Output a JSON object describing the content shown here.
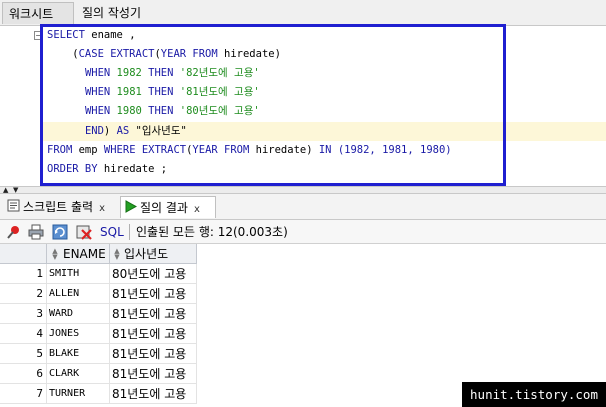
{
  "tabs": [
    {
      "label": "워크시트"
    },
    {
      "label": "질의 작성기"
    }
  ],
  "editor": {
    "lines": [
      [
        {
          "t": "SELECT ",
          "c": "kw"
        },
        {
          "t": "ename ,",
          "c": ""
        }
      ],
      [
        {
          "t": "    (",
          "c": ""
        },
        {
          "t": "CASE EXTRACT",
          "c": "kw"
        },
        {
          "t": "(",
          "c": ""
        },
        {
          "t": "YEAR FROM ",
          "c": "kw"
        },
        {
          "t": "hiredate)",
          "c": ""
        }
      ],
      [
        {
          "t": "      ",
          "c": ""
        },
        {
          "t": "WHEN ",
          "c": "kw"
        },
        {
          "t": "1982 ",
          "c": "str"
        },
        {
          "t": "THEN ",
          "c": "kw"
        },
        {
          "t": "'82년도에 고용'",
          "c": "str"
        }
      ],
      [
        {
          "t": "      ",
          "c": ""
        },
        {
          "t": "WHEN ",
          "c": "kw"
        },
        {
          "t": "1981 ",
          "c": "str"
        },
        {
          "t": "THEN ",
          "c": "kw"
        },
        {
          "t": "'81년도에 고용'",
          "c": "str"
        }
      ],
      [
        {
          "t": "      ",
          "c": ""
        },
        {
          "t": "WHEN ",
          "c": "kw"
        },
        {
          "t": "1980 ",
          "c": "str"
        },
        {
          "t": "THEN ",
          "c": "kw"
        },
        {
          "t": "'80년도에 고용'",
          "c": "str"
        }
      ],
      [
        {
          "t": "      ",
          "c": ""
        },
        {
          "t": "END",
          "c": "kw"
        },
        {
          "t": ") ",
          "c": ""
        },
        {
          "t": "AS ",
          "c": "kw"
        },
        {
          "t": "\"입사년도\"",
          "c": ""
        }
      ],
      [
        {
          "t": "FROM ",
          "c": "kw"
        },
        {
          "t": "emp ",
          "c": ""
        },
        {
          "t": "WHERE EXTRACT",
          "c": "kw"
        },
        {
          "t": "(",
          "c": ""
        },
        {
          "t": "YEAR FROM ",
          "c": "kw"
        },
        {
          "t": "hiredate) ",
          "c": ""
        },
        {
          "t": "IN ",
          "c": "kw"
        },
        {
          "t": "(1982, 1981, 1980)",
          "c": "num"
        }
      ],
      [
        {
          "t": "ORDER BY ",
          "c": "kw"
        },
        {
          "t": "hiredate ;",
          "c": ""
        }
      ]
    ]
  },
  "result_tabs": [
    {
      "label": "스크립트 출력",
      "close": "x"
    },
    {
      "label": "질의 결과",
      "close": "x"
    }
  ],
  "toolbar": {
    "sql_label": "SQL",
    "status": "인출된 모든 행: 12(0.003초)"
  },
  "grid": {
    "columns": [
      "ENAME",
      "입사년도"
    ],
    "rows": [
      {
        "n": "1",
        "ename": "SMITH",
        "year": "80년도에 고용"
      },
      {
        "n": "2",
        "ename": "ALLEN",
        "year": "81년도에 고용"
      },
      {
        "n": "3",
        "ename": "WARD",
        "year": "81년도에 고용"
      },
      {
        "n": "4",
        "ename": "JONES",
        "year": "81년도에 고용"
      },
      {
        "n": "5",
        "ename": "BLAKE",
        "year": "81년도에 고용"
      },
      {
        "n": "6",
        "ename": "CLARK",
        "year": "81년도에 고용"
      },
      {
        "n": "7",
        "ename": "TURNER",
        "year": "81년도에 고용"
      }
    ]
  },
  "watermark": "hunit.tistory.com",
  "colors": {
    "keyword": "#1a1aa6",
    "string": "#1e8c1e",
    "selection_border": "#1f1fd0"
  }
}
